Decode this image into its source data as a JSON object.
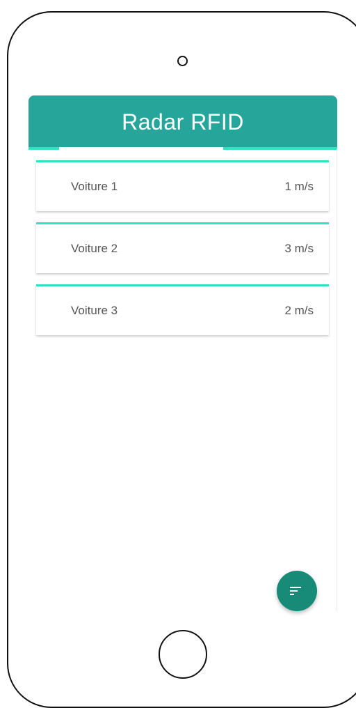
{
  "app_bar": {
    "title": "Radar RFID",
    "color": "#26a69a",
    "accent_color": "#2de3c1"
  },
  "vehicles": [
    {
      "name": "Voiture 1",
      "speed": "1 m/s"
    },
    {
      "name": "Voiture 2",
      "speed": "3 m/s"
    },
    {
      "name": "Voiture 3",
      "speed": "2 m/s"
    }
  ],
  "fab": {
    "icon": "filter-list-icon",
    "color": "#178a78"
  }
}
